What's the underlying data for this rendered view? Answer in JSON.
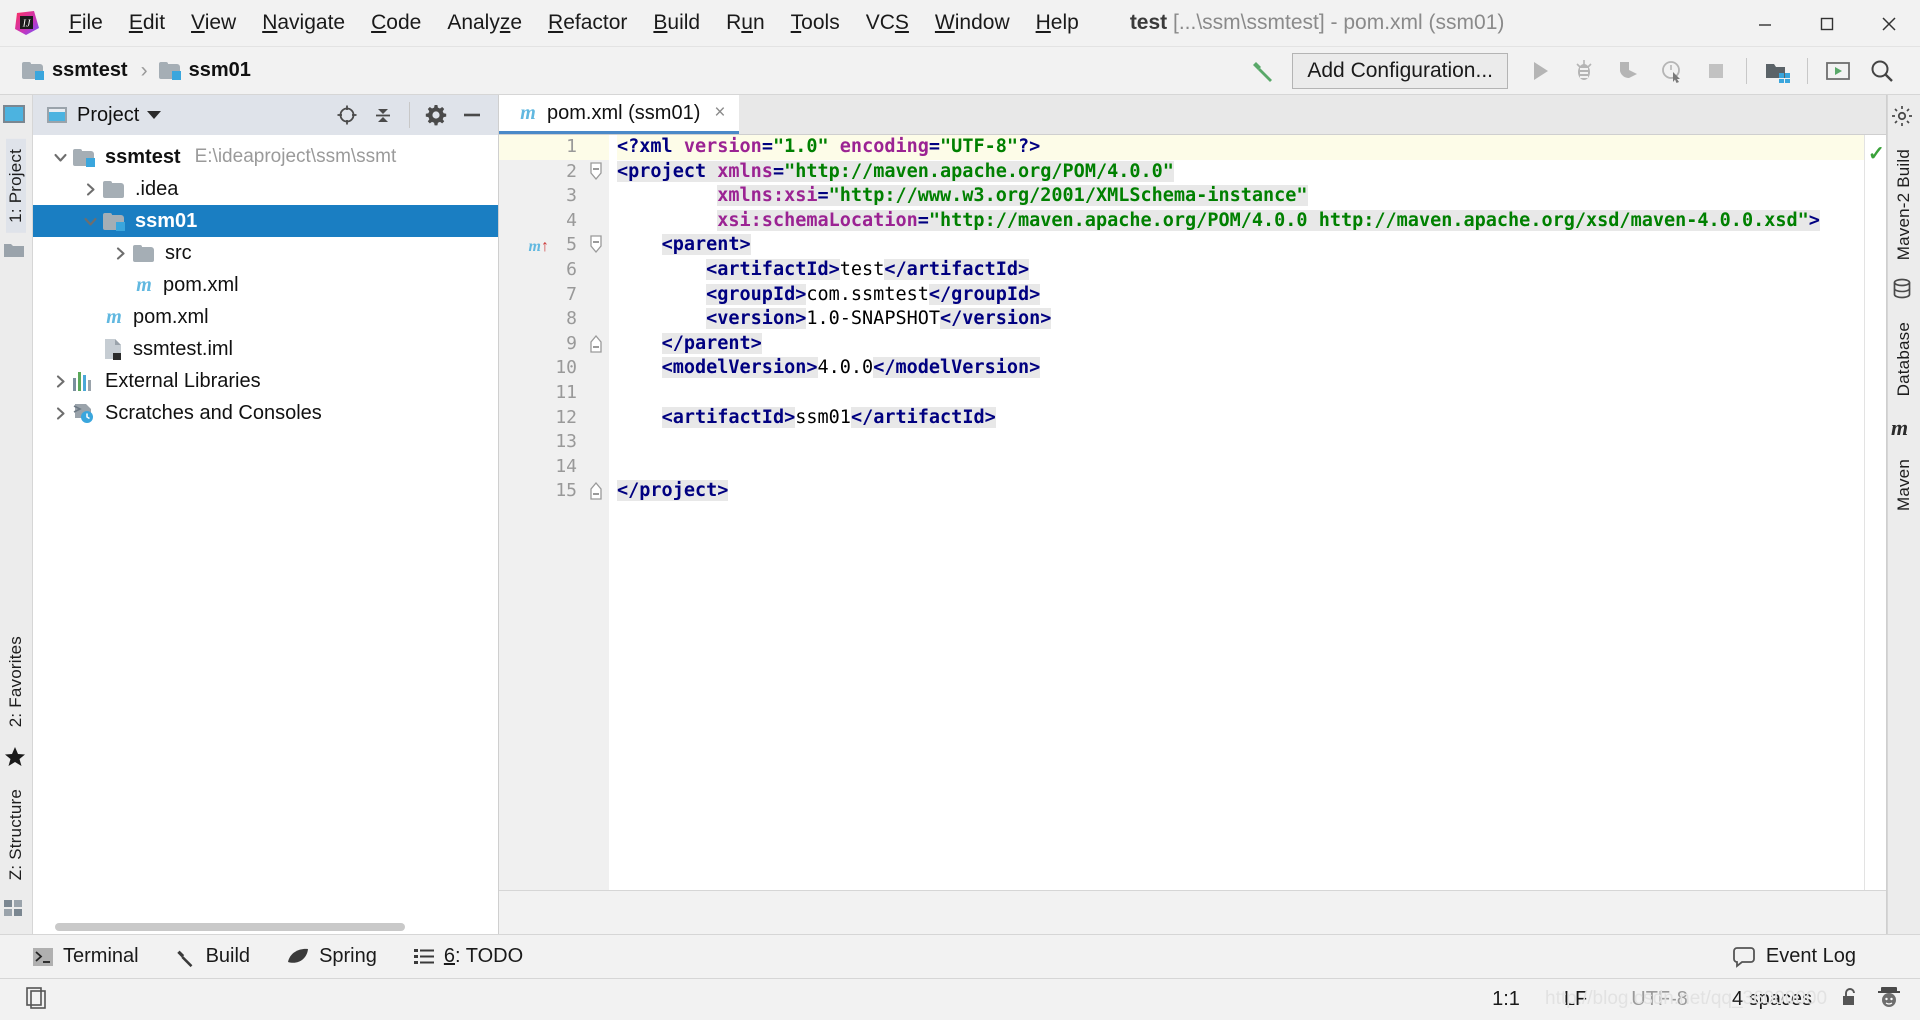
{
  "window": {
    "title_bold": "test",
    "title_rest": " [...\\ssm\\ssmtest] - pom.xml (ssm01)",
    "minimize": "—",
    "maximize": "❐",
    "close": "✕"
  },
  "menubar": {
    "items": [
      {
        "pre": "",
        "mn": "F",
        "post": "ile"
      },
      {
        "pre": "",
        "mn": "E",
        "post": "dit"
      },
      {
        "pre": "",
        "mn": "V",
        "post": "iew"
      },
      {
        "pre": "",
        "mn": "N",
        "post": "avigate"
      },
      {
        "pre": "",
        "mn": "C",
        "post": "ode"
      },
      {
        "pre": "Analy",
        "mn": "z",
        "post": "e"
      },
      {
        "pre": "",
        "mn": "R",
        "post": "efactor"
      },
      {
        "pre": "",
        "mn": "B",
        "post": "uild"
      },
      {
        "pre": "R",
        "mn": "u",
        "post": "n"
      },
      {
        "pre": "",
        "mn": "T",
        "post": "ools"
      },
      {
        "pre": "VC",
        "mn": "S",
        "post": ""
      },
      {
        "pre": "",
        "mn": "W",
        "post": "indow"
      },
      {
        "pre": "",
        "mn": "H",
        "post": "elp"
      }
    ]
  },
  "navbar": {
    "breadcrumb": [
      {
        "label": "ssmtest",
        "icon": "module-folder-icon"
      },
      {
        "label": "ssm01",
        "icon": "module-folder-icon"
      }
    ],
    "separator": "›",
    "add_configuration": "Add Configuration...",
    "icons": [
      "build-hammer-icon",
      "run-icon",
      "debug-icon",
      "coverage-icon",
      "profiler-icon",
      "stop-icon",
      "project-structure-icon",
      "update-icon",
      "search-everywhere-icon"
    ]
  },
  "left_strip": {
    "tabs": [
      "1: Project",
      "2: Favorites",
      "Z: Structure"
    ],
    "active": "1: Project"
  },
  "right_strip": {
    "tabs": [
      "Maven-2 Build",
      "Database",
      "Maven"
    ]
  },
  "project_panel": {
    "title": "Project",
    "actions": [
      "locate-icon",
      "collapse-all-icon",
      "settings-gear-icon",
      "hide-icon"
    ],
    "tree": [
      {
        "indent": 0,
        "twist": "open",
        "icon": "module-folder-icon",
        "label": "ssmtest",
        "bold": true,
        "path": "E:\\ideaproject\\ssm\\ssmt",
        "selected": false
      },
      {
        "indent": 1,
        "twist": "closed",
        "icon": "folder-icon",
        "label": ".idea",
        "bold": false,
        "path": "",
        "selected": false
      },
      {
        "indent": 1,
        "twist": "open",
        "icon": "module-folder-icon",
        "label": "ssm01",
        "bold": true,
        "path": "",
        "selected": true
      },
      {
        "indent": 2,
        "twist": "closed",
        "icon": "folder-icon",
        "label": "src",
        "bold": false,
        "path": "",
        "selected": false
      },
      {
        "indent": 2,
        "twist": "none",
        "icon": "maven-icon",
        "label": "pom.xml",
        "bold": false,
        "path": "",
        "selected": false
      },
      {
        "indent": 1,
        "twist": "none",
        "icon": "maven-icon",
        "label": "pom.xml",
        "bold": false,
        "path": "",
        "selected": false
      },
      {
        "indent": 1,
        "twist": "none",
        "icon": "iml-icon",
        "label": "ssmtest.iml",
        "bold": false,
        "path": "",
        "selected": false
      },
      {
        "indent": 0,
        "twist": "closed",
        "icon": "external-libraries-icon",
        "label": "External Libraries",
        "bold": false,
        "path": "",
        "selected": false
      },
      {
        "indent": 0,
        "twist": "closed",
        "icon": "scratches-icon",
        "label": "Scratches and Consoles",
        "bold": false,
        "path": "",
        "selected": false
      }
    ]
  },
  "editor": {
    "tab": {
      "label": "pom.xml (ssm01)",
      "icon": "maven-icon",
      "close": "×"
    },
    "inspection_ok": "✓",
    "gutter_icon_line5": "m",
    "lines": [
      {
        "n": "1",
        "fold": "none",
        "html": "<span class=\"pidef\">&lt;?</span><span class=\"pidef\">xml </span><span class=\"attr\" style=\"background:transparent\">version</span><span class=\"pidef\">=</span><span class=\"str\" style=\"background:transparent\">\"1.0\"</span><span class=\"pidef\"> </span><span class=\"attr\" style=\"background:transparent\">encoding</span><span class=\"pidef\">=</span><span class=\"str\" style=\"background:transparent\">\"UTF-8\"</span><span class=\"pidef\">?&gt;</span>"
      },
      {
        "n": "2",
        "fold": "open",
        "html": "<span class=\"punct\">&lt;</span><span class=\"tagname\">project </span><span class=\"attr\">xmlns</span><span class=\"punct\">=</span><span class=\"str\">\"http://maven.apache.org/POM/4.0.0\"</span>"
      },
      {
        "n": "3",
        "fold": "none",
        "html": "         <span class=\"attr\">xmlns:xsi</span><span class=\"punct\">=</span><span class=\"str\">\"http://www.w3.org/2001/XMLSchema-instance\"</span>"
      },
      {
        "n": "4",
        "fold": "none",
        "html": "         <span class=\"attr\">xsi:schemaLocation</span><span class=\"punct\">=</span><span class=\"str\">\"http://maven.apache.org/POM/4.0.0 http://maven.apache.org/xsd/maven-4.0.0.xsd\"</span><span class=\"punct\">&gt;</span>"
      },
      {
        "n": "5",
        "fold": "open",
        "html": "    <span class=\"punct\">&lt;</span><span class=\"tagname\">parent</span><span class=\"punct\">&gt;</span>"
      },
      {
        "n": "6",
        "fold": "none",
        "html": "        <span class=\"punct\">&lt;</span><span class=\"tagname\">artifactId</span><span class=\"punct\">&gt;</span><span class=\"txt\">test</span><span class=\"punct\">&lt;/</span><span class=\"tagname\">artifactId</span><span class=\"punct\">&gt;</span>"
      },
      {
        "n": "7",
        "fold": "none",
        "html": "        <span class=\"punct\">&lt;</span><span class=\"tagname\">groupId</span><span class=\"punct\">&gt;</span><span class=\"txt\">com.ssmtest</span><span class=\"punct\">&lt;/</span><span class=\"tagname\">groupId</span><span class=\"punct\">&gt;</span>"
      },
      {
        "n": "8",
        "fold": "none",
        "html": "        <span class=\"punct\">&lt;</span><span class=\"tagname\">version</span><span class=\"punct\">&gt;</span><span class=\"txt\">1.0-SNAPSHOT</span><span class=\"punct\">&lt;/</span><span class=\"tagname\">version</span><span class=\"punct\">&gt;</span>"
      },
      {
        "n": "9",
        "fold": "close",
        "html": "    <span class=\"punct\">&lt;/</span><span class=\"tagname\">parent</span><span class=\"punct\">&gt;</span>"
      },
      {
        "n": "10",
        "fold": "none",
        "html": "    <span class=\"punct\">&lt;</span><span class=\"tagname\">modelVersion</span><span class=\"punct\">&gt;</span><span class=\"txt\">4.0.0</span><span class=\"punct\">&lt;/</span><span class=\"tagname\">modelVersion</span><span class=\"punct\">&gt;</span>"
      },
      {
        "n": "11",
        "fold": "none",
        "html": ""
      },
      {
        "n": "12",
        "fold": "none",
        "html": "    <span class=\"punct\">&lt;</span><span class=\"tagname\">artifactId</span><span class=\"punct\">&gt;</span><span class=\"txt\">ssm01</span><span class=\"punct\">&lt;/</span><span class=\"tagname\">artifactId</span><span class=\"punct\">&gt;</span>"
      },
      {
        "n": "13",
        "fold": "none",
        "html": ""
      },
      {
        "n": "14",
        "fold": "none",
        "html": ""
      },
      {
        "n": "15",
        "fold": "close",
        "html": "<span class=\"punct\">&lt;/</span><span class=\"tagname\">project</span><span class=\"punct\">&gt;</span>"
      }
    ],
    "raw_text": [
      "<?xml version=\"1.0\" encoding=\"UTF-8\"?>",
      "<project xmlns=\"http://maven.apache.org/POM/4.0.0\"",
      "         xmlns:xsi=\"http://www.w3.org/2001/XMLSchema-instance\"",
      "         xsi:schemaLocation=\"http://maven.apache.org/POM/4.0.0 http://maven.apache.org/xsd/maven-4.0.0.xsd\">",
      "    <parent>",
      "        <artifactId>test</artifactId>",
      "        <groupId>com.ssmtest</groupId>",
      "        <version>1.0-SNAPSHOT</version>",
      "    </parent>",
      "    <modelVersion>4.0.0</modelVersion>",
      "",
      "    <artifactId>ssm01</artifactId>",
      "",
      "",
      "</project>"
    ]
  },
  "bottom_bar": {
    "items": [
      {
        "label": "Terminal",
        "icon": "terminal-icon",
        "mn": ""
      },
      {
        "label": "Build",
        "icon": "build-hammer-icon",
        "mn": ""
      },
      {
        "label": "Spring",
        "icon": "spring-leaf-icon",
        "mn": ""
      },
      {
        "label": "6: TODO",
        "icon": "todo-list-icon",
        "mn": "6"
      }
    ],
    "event_log": {
      "label": "Event Log",
      "icon": "event-log-icon"
    }
  },
  "statusbar": {
    "caret": "1:1",
    "line_separator": "LF",
    "encoding": "UTF-8",
    "indent": "4 spaces",
    "lock_icon": "unlocked-icon",
    "user_icon": "avatar-icon",
    "watermark": "http://blog.csdn.net/qq_36000000"
  },
  "colors": {
    "accent_selection": "#1a7ec2",
    "tab_underline": "#4a89c8",
    "maven_blue": "#61b8e0",
    "string_green": "#008000",
    "tag_navy": "#000080",
    "attr_purple": "#9b2393",
    "ok_green": "#3aa23a"
  }
}
